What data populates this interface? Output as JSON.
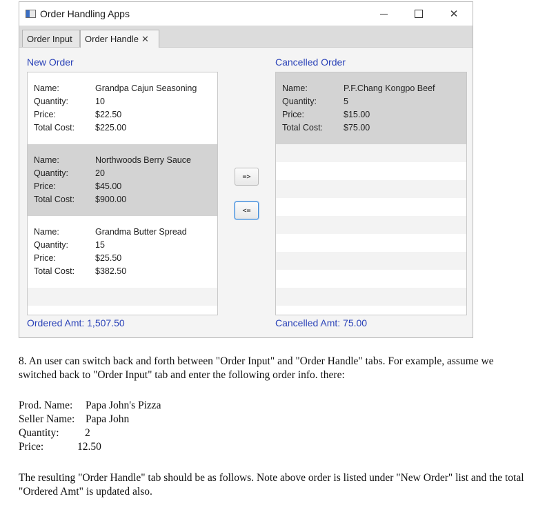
{
  "window": {
    "title": "Order Handling Apps",
    "controls": {
      "minimize": "–",
      "close": "✕"
    }
  },
  "tabs": [
    {
      "label": "Order Input",
      "active": false
    },
    {
      "label": "Order Handle",
      "active": true,
      "close_glyph": "✕"
    }
  ],
  "new_order": {
    "title": "New Order",
    "field_labels": {
      "name": "Name:",
      "quantity": "Quantity:",
      "price": "Price:",
      "total": "Total Cost:"
    },
    "items": [
      {
        "name": "Grandpa Cajun Seasoning",
        "quantity": "10",
        "price": "$22.50",
        "total": "$225.00",
        "selected": false
      },
      {
        "name": "Northwoods Berry Sauce",
        "quantity": "20",
        "price": "$45.00",
        "total": "$900.00",
        "selected": true
      },
      {
        "name": "Grandma Butter Spread",
        "quantity": "15",
        "price": "$25.50",
        "total": "$382.50",
        "selected": false
      }
    ],
    "amount_text": "Ordered Amt: 1,507.50"
  },
  "cancelled_order": {
    "title": "Cancelled Order",
    "items": [
      {
        "name": "P.F.Chang Kongpo Beef",
        "quantity": "5",
        "price": "$15.00",
        "total": "$75.00",
        "selected": true
      }
    ],
    "amount_text": "Cancelled Amt: 75.00"
  },
  "buttons": {
    "move_right": "=>",
    "move_left": "<="
  },
  "document": {
    "paragraph1": "8. An user can switch back and forth between \"Order Input\" and \"Order Handle\" tabs. For example, assume we switched back to \"Order Input\" tab and enter the following order info. there:",
    "fields": [
      {
        "label": "Prod. Name:",
        "value": "Papa John's Pizza"
      },
      {
        "label": "Seller Name:",
        "value": "Papa John"
      },
      {
        "label": "Quantity:",
        "value": "2"
      },
      {
        "label": "Price:",
        "value": "12.50"
      }
    ],
    "paragraph2": "The resulting \"Order Handle\" tab should be as follows. Note above order is listed under \"New Order\" list and the total \"Ordered Amt\" is updated also."
  }
}
